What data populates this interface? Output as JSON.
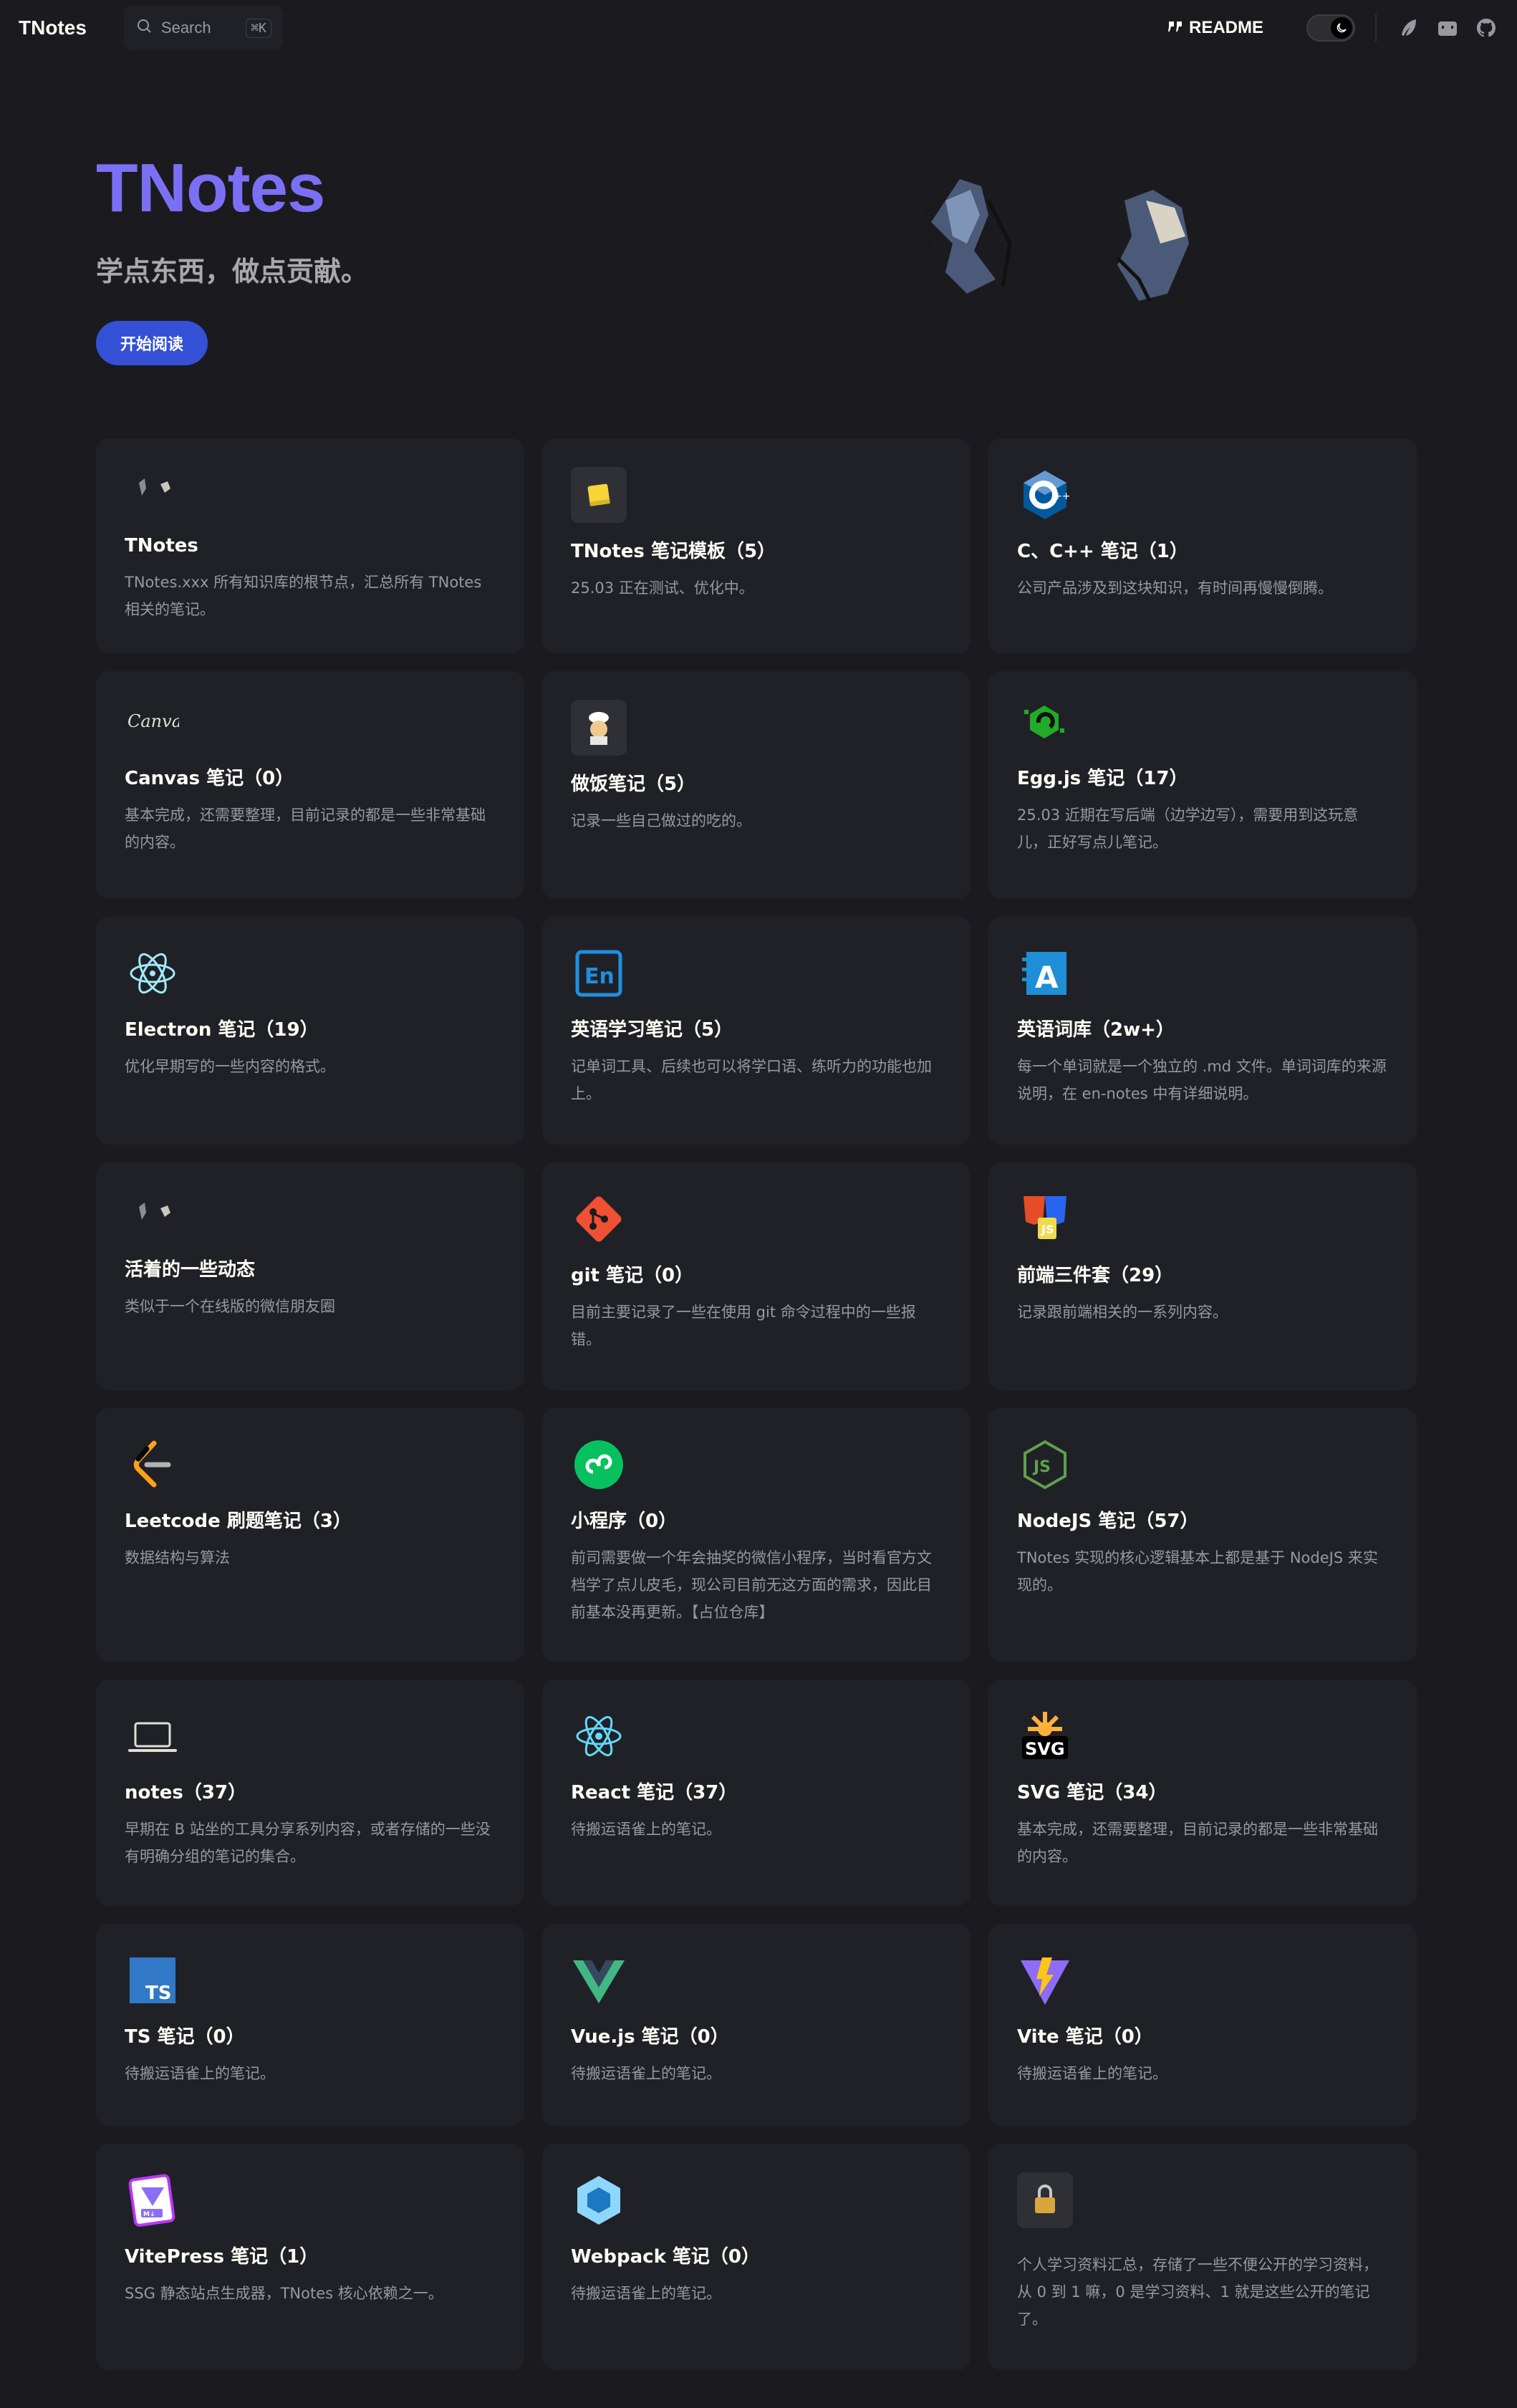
{
  "nav": {
    "brand": "TNotes",
    "search_label": "Search",
    "search_shortcut": "⌘K",
    "readme_label": "README"
  },
  "hero": {
    "title": "TNotes",
    "tagline": "学点东西，做点贡献。",
    "button_label": "开始阅读"
  },
  "cards": [
    {
      "icon": "tnotes-icon",
      "title": "TNotes",
      "desc": "TNotes.xxx 所有知识库的根节点，汇总所有 TNotes 相关的笔记。"
    },
    {
      "icon": "sticky-note-icon",
      "title": "TNotes 笔记模板（5）",
      "desc": "25.03 正在测试、优化中。"
    },
    {
      "icon": "cpp-icon",
      "title": "C、C++ 笔记（1）",
      "desc": "公司产品涉及到这块知识，有时间再慢慢倒腾。"
    },
    {
      "icon": "canva-icon",
      "title": "Canvas 笔记（0）",
      "desc": "基本完成，还需要整理，目前记录的都是一些非常基础的内容。"
    },
    {
      "icon": "chef-icon",
      "title": "做饭笔记（5）",
      "desc": "记录一些自己做过的吃的。"
    },
    {
      "icon": "eggjs-icon",
      "title": "Egg.js 笔记（17）",
      "desc": "25.03 近期在写后端（边学边写），需要用到这玩意儿，正好写点儿笔记。"
    },
    {
      "icon": "electron-icon",
      "title": "Electron 笔记（19）",
      "desc": "优化早期写的一些内容的格式。"
    },
    {
      "icon": "english-icon",
      "title": "英语学习笔记（5）",
      "desc": "记单词工具、后续也可以将学口语、练听力的功能也加上。"
    },
    {
      "icon": "dictionary-icon",
      "title": "英语词库（2w+）",
      "desc": "每一个单词就是一个独立的 .md 文件。单词词库的来源说明，在 en-notes 中有详细说明。"
    },
    {
      "icon": "moments-icon",
      "title": "活着的一些动态",
      "desc": "类似于一个在线版的微信朋友圈"
    },
    {
      "icon": "git-icon",
      "title": "git 笔记（0）",
      "desc": "目前主要记录了一些在使用 git 命令过程中的一些报错。"
    },
    {
      "icon": "html-css-js-icon",
      "title": "前端三件套（29）",
      "desc": "记录跟前端相关的一系列内容。"
    },
    {
      "icon": "leetcode-icon",
      "title": "Leetcode 刷题笔记（3）",
      "desc": "数据结构与算法"
    },
    {
      "icon": "miniprogram-icon",
      "title": "小程序（0）",
      "desc": "前司需要做一个年会抽奖的微信小程序，当时看官方文档学了点儿皮毛，现公司目前无这方面的需求，因此目前基本没再更新。【占位仓库】"
    },
    {
      "icon": "nodejs-icon",
      "title": "NodeJS 笔记（57）",
      "desc": "TNotes 实现的核心逻辑基本上都是基于 NodeJS 来实现的。"
    },
    {
      "icon": "laptop-icon",
      "title": "notes（37）",
      "desc": "早期在 B 站坐的工具分享系列内容，或者存储的一些没有明确分组的笔记的集合。"
    },
    {
      "icon": "react-icon",
      "title": "React 笔记（37）",
      "desc": "待搬运语雀上的笔记。"
    },
    {
      "icon": "svg-icon",
      "title": "SVG 笔记（34）",
      "desc": "基本完成，还需要整理，目前记录的都是一些非常基础的内容。"
    },
    {
      "icon": "typescript-icon",
      "title": "TS 笔记（0）",
      "desc": "待搬运语雀上的笔记。"
    },
    {
      "icon": "vue-icon",
      "title": "Vue.js 笔记（0）",
      "desc": "待搬运语雀上的笔记。"
    },
    {
      "icon": "vite-icon",
      "title": "Vite 笔记（0）",
      "desc": "待搬运语雀上的笔记。"
    },
    {
      "icon": "vitepress-icon",
      "title": "VitePress 笔记（1）",
      "desc": "SSG 静态站点生成器，TNotes 核心依赖之一。"
    },
    {
      "icon": "webpack-icon",
      "title": "Webpack 笔记（0）",
      "desc": "待搬运语雀上的笔记。"
    },
    {
      "icon": "lock-icon",
      "title": "",
      "desc": "个人学习资料汇总，存储了一些不便公开的学习资料，从 0 到 1 嘛，0 是学习资料、1 就是这些公开的笔记了。"
    }
  ]
}
